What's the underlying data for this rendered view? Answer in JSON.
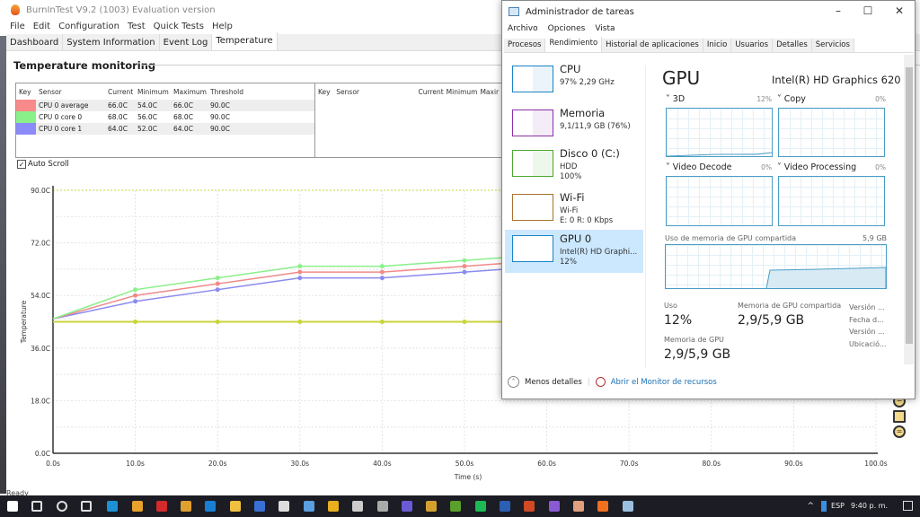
{
  "burnintest": {
    "title": "BurnInTest V9.2 (1003) Evaluation version",
    "menu": [
      "File",
      "Edit",
      "Configuration",
      "Test",
      "Quick Tests",
      "Help"
    ],
    "tabs": [
      "Dashboard",
      "System Information",
      "Event Log",
      "Temperature"
    ],
    "active_tab": "Temperature",
    "heading": "Temperature monitoring",
    "table_headers": [
      "Key",
      "Sensor",
      "Current",
      "Minimum",
      "Maximum",
      "Threshold"
    ],
    "table_headers_right": [
      "Key",
      "Sensor",
      "Current",
      "Minimum",
      "Maxir"
    ],
    "rows": [
      {
        "color": "#f88a8a",
        "sensor": "CPU 0 average",
        "current": "66.0C",
        "minimum": "54.0C",
        "maximum": "66.0C",
        "threshold": "90.0C"
      },
      {
        "color": "#8af08a",
        "sensor": "CPU 0 core 0",
        "current": "68.0C",
        "minimum": "56.0C",
        "maximum": "68.0C",
        "threshold": "90.0C"
      },
      {
        "color": "#8a8af8",
        "sensor": "CPU 0 core 1",
        "current": "64.0C",
        "minimum": "52.0C",
        "maximum": "64.0C",
        "threshold": "90.0C"
      }
    ],
    "auto_scroll_label": "Auto Scroll",
    "auto_scroll_checked": true,
    "status": "Ready"
  },
  "chart_data": {
    "type": "line",
    "xlabel": "Time (s)",
    "ylabel": "Temperature",
    "xlim": [
      0,
      100
    ],
    "ylim": [
      0,
      90
    ],
    "x_ticks": [
      "0.0s",
      "10.0s",
      "20.0s",
      "30.0s",
      "40.0s",
      "50.0s",
      "60.0s",
      "70.0s",
      "80.0s",
      "90.0s",
      "100.0s"
    ],
    "y_ticks": [
      "0.0C",
      "18.0C",
      "36.0C",
      "54.0C",
      "72.0C",
      "90.0C"
    ],
    "threshold": 90,
    "grid": true,
    "x": [
      0,
      10,
      20,
      30,
      40,
      50,
      60
    ],
    "series": [
      {
        "name": "CPU 0 core 0",
        "color": "#8af08a",
        "values": [
          46,
          56,
          60,
          64,
          64,
          66,
          68
        ]
      },
      {
        "name": "CPU 0 average",
        "color": "#f08a8a",
        "values": [
          46,
          54,
          58,
          62,
          62,
          64,
          66
        ]
      },
      {
        "name": "CPU 0 core 1",
        "color": "#8a8af0",
        "values": [
          46,
          52,
          56,
          60,
          60,
          62,
          64
        ]
      },
      {
        "color": "#c8d43a",
        "values": [
          45,
          45,
          45,
          45,
          45,
          45,
          45
        ]
      }
    ]
  },
  "taskmgr": {
    "title": "Administrador de tareas",
    "menu": [
      "Archivo",
      "Opciones",
      "Vista"
    ],
    "tabs": [
      "Procesos",
      "Rendimiento",
      "Historial de aplicaciones",
      "Inicio",
      "Usuarios",
      "Detalles",
      "Servicios"
    ],
    "active_tab": "Rendimiento",
    "resources": [
      {
        "name": "CPU",
        "sub1": "97% 2,29 GHz",
        "sub2": "",
        "color": "#1a84c4"
      },
      {
        "name": "Memoria",
        "sub1": "9,1/11,9 GB (76%)",
        "sub2": "",
        "color": "#8b2fa8"
      },
      {
        "name": "Disco 0 (C:)",
        "sub1": "HDD",
        "sub2": "100%",
        "color": "#4ea72e"
      },
      {
        "name": "Wi-Fi",
        "sub1": "Wi-Fi",
        "sub2": "E: 0 R: 0 Kbps",
        "color": "#a7722e"
      },
      {
        "name": "GPU 0",
        "sub1": "Intel(R) HD Graphi...",
        "sub2": "12%",
        "color": "#1a84c4"
      }
    ],
    "gpu": {
      "heading": "GPU",
      "model": "Intel(R) HD Graphics 620",
      "engines": [
        {
          "label": "3D",
          "pct": "12%"
        },
        {
          "label": "Copy",
          "pct": "0%"
        },
        {
          "label": "Video Decode",
          "pct": "0%"
        },
        {
          "label": "Video Processing",
          "pct": "0%"
        }
      ],
      "shared_label": "Uso de memoria de GPU compartida",
      "shared_max": "5,9 GB",
      "uso_label": "Uso",
      "uso": "12%",
      "shared_mem_label": "Memoria de GPU compartida",
      "shared_mem": "2,9/5,9 GB",
      "gpu_mem_label": "Memoria de GPU",
      "gpu_mem": "2,9/5,9 GB",
      "info": [
        "Versión ...",
        "Fecha d...",
        "Versión ...",
        "Ubicació..."
      ]
    },
    "less_details": "Menos detalles",
    "resource_monitor": "Abrir el Monitor de recursos"
  },
  "taskbar": {
    "icons": [
      "start",
      "search",
      "cortana",
      "task-view",
      "edge",
      "chrome",
      "opera",
      "store",
      "mail",
      "explorer",
      "steam-like",
      "epic",
      "app",
      "rockstar",
      "app2",
      "app3",
      "discord",
      "app4",
      "minecraft",
      "spotify",
      "word",
      "powerpoint",
      "app5",
      "app6",
      "burnintest",
      "taskmanager"
    ],
    "icon_colors": [
      "#fff",
      "#ddd",
      "#ddd",
      "#ddd",
      "#1e90d6",
      "#e8a12b",
      "#d32b2b",
      "#e0a030",
      "#1a7fd4",
      "#f0c040",
      "#3a6fd4",
      "#ddd",
      "#5a9fe0",
      "#e8b020",
      "#ccc",
      "#aaa",
      "#6a5ad4",
      "#d4a030",
      "#5aa02a",
      "#1db954",
      "#2b5fb4",
      "#d04a24",
      "#8a5ad4",
      "#e0a080",
      "#f07020",
      "#9ac0e0"
    ],
    "language": "ESP",
    "time": "9:40 p. m."
  }
}
